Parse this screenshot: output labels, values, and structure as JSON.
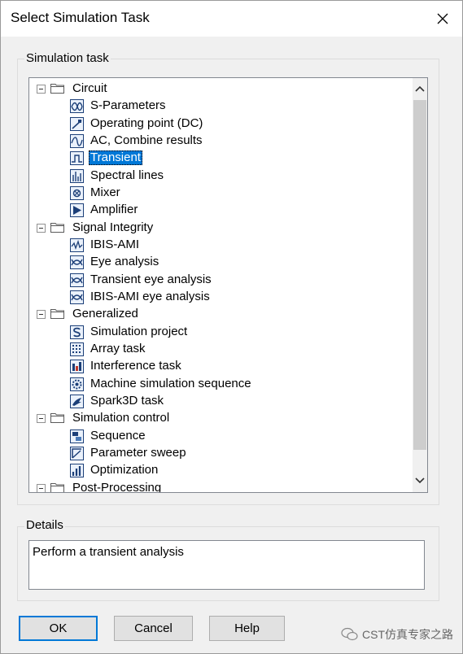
{
  "window": {
    "title": "Select Simulation Task"
  },
  "simulation_task": {
    "label": "Simulation task",
    "groups": [
      {
        "label": "Circuit",
        "items": [
          "S-Parameters",
          "Operating point (DC)",
          "AC, Combine results",
          "Transient",
          "Spectral lines",
          "Mixer",
          "Amplifier"
        ]
      },
      {
        "label": "Signal Integrity",
        "items": [
          "IBIS-AMI",
          "Eye analysis",
          "Transient eye analysis",
          "IBIS-AMI eye analysis"
        ]
      },
      {
        "label": "Generalized",
        "items": [
          "Simulation project",
          "Array task",
          "Interference task",
          "Machine simulation sequence",
          "Spark3D task"
        ]
      },
      {
        "label": "Simulation control",
        "items": [
          "Sequence",
          "Parameter sweep",
          "Optimization"
        ]
      },
      {
        "label": "Post-Processing",
        "items": []
      }
    ],
    "selected": "Transient"
  },
  "details": {
    "label": "Details",
    "text": "Perform a transient analysis"
  },
  "buttons": {
    "ok": "OK",
    "cancel": "Cancel",
    "help": "Help"
  },
  "watermark": {
    "text": "CST仿真专家之路"
  },
  "colors": {
    "selection": "#0078d7",
    "dialog_bg": "#f0f0f0",
    "icon_border": "#1c3f78"
  }
}
